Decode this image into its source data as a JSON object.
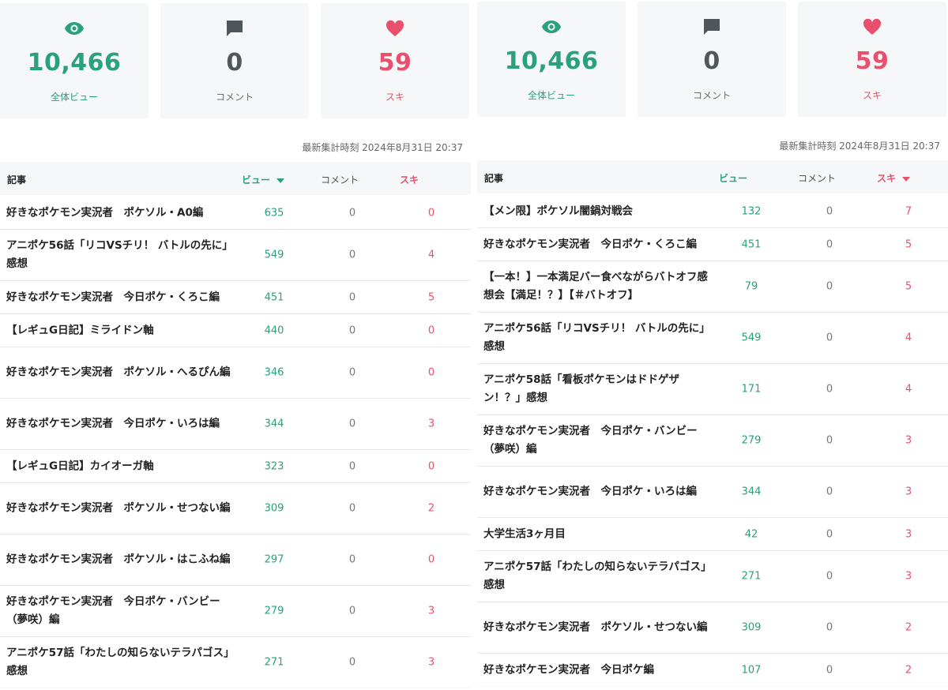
{
  "colors": {
    "view": "#2aa07c",
    "comment": "#50575b",
    "like": "#e8506d",
    "card_bg": "#f5f7f8"
  },
  "panels": [
    {
      "stats": [
        {
          "icon": "eye-icon",
          "value": "10,466",
          "label": "全体ビュー"
        },
        {
          "icon": "comment-icon",
          "value": "0",
          "label": "コメント"
        },
        {
          "icon": "heart-icon",
          "value": "59",
          "label": "スキ"
        }
      ],
      "timestamp": "最新集計時刻 2024年8月31日 20:37",
      "headers": {
        "article": "記事",
        "view": "ビュー",
        "comment": "コメント",
        "like": "スキ"
      },
      "sorted_by": "view",
      "rows": [
        {
          "title": "好きなポケモン実況者　ポケソル・A0編",
          "views": "635",
          "comments": "0",
          "likes": "0"
        },
        {
          "title": "アニポケ56話「リコVSチリ！ バトルの先に」感想",
          "views": "549",
          "comments": "0",
          "likes": "4"
        },
        {
          "title": "好きなポケモン実況者　今日ポケ・くろこ編",
          "views": "451",
          "comments": "0",
          "likes": "5"
        },
        {
          "title": "【レギュG日記】ミライドン軸",
          "views": "440",
          "comments": "0",
          "likes": "0"
        },
        {
          "title": "好きなポケモン実況者　ポケソル・へるぴん編",
          "views": "346",
          "comments": "0",
          "likes": "0"
        },
        {
          "title": "好きなポケモン実況者　今日ポケ・いろは編",
          "views": "344",
          "comments": "0",
          "likes": "3"
        },
        {
          "title": "【レギュG日記】カイオーガ軸",
          "views": "323",
          "comments": "0",
          "likes": "0"
        },
        {
          "title": "好きなポケモン実況者　ポケソル・せつない編",
          "views": "309",
          "comments": "0",
          "likes": "2"
        },
        {
          "title": "好きなポケモン実況者　ポケソル・はこふね編",
          "views": "297",
          "comments": "0",
          "likes": "0"
        },
        {
          "title": "好きなポケモン実況者　今日ポケ・バンビー（夢咲）編",
          "views": "279",
          "comments": "0",
          "likes": "3"
        },
        {
          "title": "アニポケ57話「わたしの知らないテラパゴス」感想",
          "views": "271",
          "comments": "0",
          "likes": "3"
        }
      ]
    },
    {
      "stats": [
        {
          "icon": "eye-icon",
          "value": "10,466",
          "label": "全体ビュー"
        },
        {
          "icon": "comment-icon",
          "value": "0",
          "label": "コメント"
        },
        {
          "icon": "heart-icon",
          "value": "59",
          "label": "スキ"
        }
      ],
      "timestamp": "最新集計時刻 2024年8月31日 20:37",
      "headers": {
        "article": "記事",
        "view": "ビュー",
        "comment": "コメント",
        "like": "スキ"
      },
      "sorted_by": "like",
      "rows": [
        {
          "title": "【メン限】ポケソル闇鍋対戦会",
          "views": "132",
          "comments": "0",
          "likes": "7"
        },
        {
          "title": "好きなポケモン実況者　今日ポケ・くろこ編",
          "views": "451",
          "comments": "0",
          "likes": "5"
        },
        {
          "title": "【一本！】一本満足バー食べながらバトオフ感想会【満足！？】【＃バトオフ】",
          "views": "79",
          "comments": "0",
          "likes": "5"
        },
        {
          "title": "アニポケ56話「リコVSチリ！ バトルの先に」感想",
          "views": "549",
          "comments": "0",
          "likes": "4"
        },
        {
          "title": "アニポケ58話「看板ポケモンはドドゲザン！？」感想",
          "views": "171",
          "comments": "0",
          "likes": "4"
        },
        {
          "title": "好きなポケモン実況者　今日ポケ・バンビー（夢咲）編",
          "views": "279",
          "comments": "0",
          "likes": "3"
        },
        {
          "title": "好きなポケモン実況者　今日ポケ・いろは編",
          "views": "344",
          "comments": "0",
          "likes": "3"
        },
        {
          "title": "大学生活3ヶ月目",
          "views": "42",
          "comments": "0",
          "likes": "3"
        },
        {
          "title": "アニポケ57話「わたしの知らないテラパゴス」感想",
          "views": "271",
          "comments": "0",
          "likes": "3"
        },
        {
          "title": "好きなポケモン実況者　ポケソル・せつない編",
          "views": "309",
          "comments": "0",
          "likes": "2"
        },
        {
          "title": "好きなポケモン実況者　今日ポケ編",
          "views": "107",
          "comments": "0",
          "likes": "2"
        }
      ]
    }
  ]
}
